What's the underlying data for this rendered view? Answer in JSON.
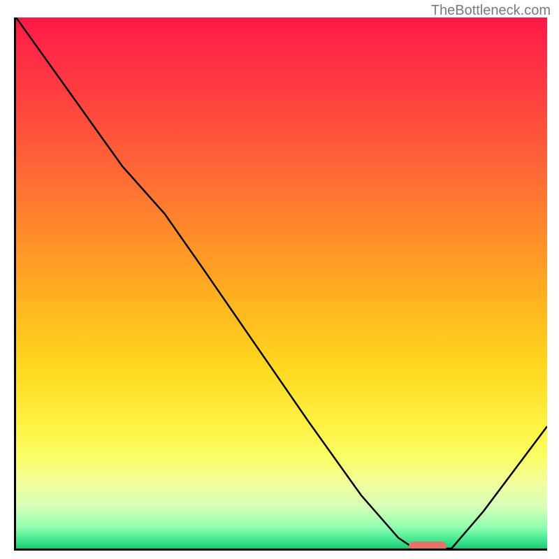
{
  "watermark": "TheBottleneck.com",
  "chart_data": {
    "type": "line",
    "x": [
      0,
      5,
      10,
      15,
      20,
      24,
      28,
      35,
      45,
      55,
      65,
      72,
      75,
      78,
      82,
      88,
      94,
      100
    ],
    "values": [
      100,
      93,
      86,
      79,
      72,
      67.5,
      63,
      53,
      38.5,
      24,
      10,
      2,
      0,
      0,
      0,
      7,
      15,
      23
    ],
    "title": "",
    "xlabel": "",
    "ylabel": "",
    "xlim": [
      0,
      100
    ],
    "ylim": [
      0,
      100
    ],
    "marker_range_x": [
      74,
      81
    ],
    "marker_y": 0,
    "gradient_colors": {
      "top": "#ff1846",
      "mid_high": "#ff9028",
      "mid": "#ffd820",
      "mid_low": "#fbff68",
      "bottom": "#20c870"
    }
  }
}
